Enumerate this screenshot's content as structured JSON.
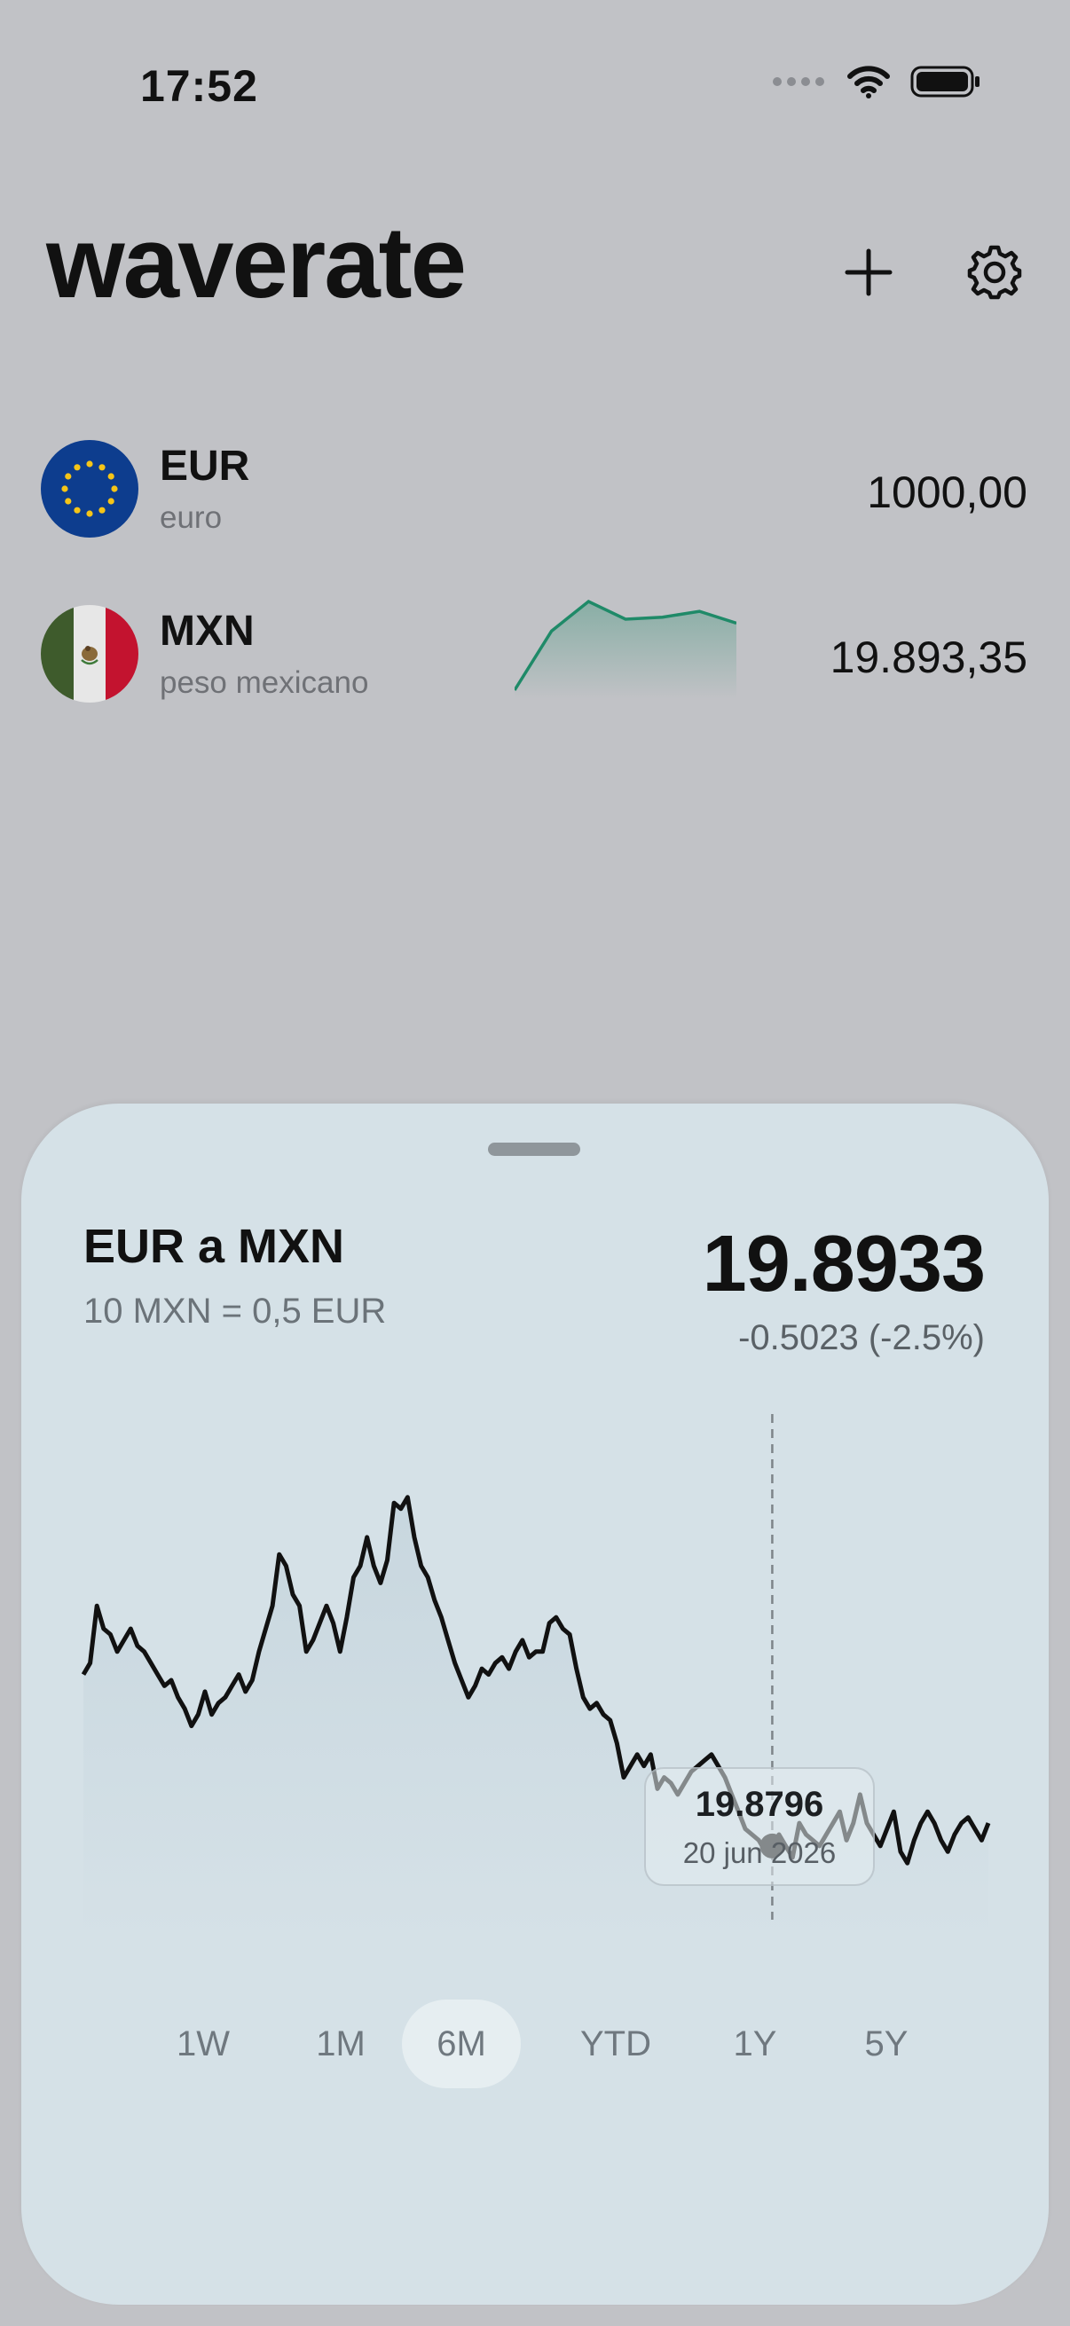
{
  "status": {
    "time": "17:52"
  },
  "app": {
    "title": "waverate"
  },
  "currencies": [
    {
      "code": "EUR",
      "name": "euro",
      "amount": "1000,00"
    },
    {
      "code": "MXN",
      "name": "peso mexicano",
      "amount": "19.893,35"
    }
  ],
  "sparkline": {
    "color": "#1f8a68",
    "values": [
      3.0,
      3.3,
      3.45,
      3.36,
      3.37,
      3.4,
      3.34
    ]
  },
  "sheet": {
    "pair_title": "EUR a MXN",
    "conversion_note": "10 MXN = 0,5 EUR",
    "rate": "19.8933",
    "change": "-0.5023 (-2.5%)",
    "tooltip": {
      "value": "19.8796",
      "date": "20 jun 2026"
    },
    "ranges": [
      "1W",
      "1M",
      "6M",
      "YTD",
      "1Y",
      "5Y"
    ],
    "active_range": "6M"
  },
  "chart_data": {
    "type": "line",
    "y": [
      20.16,
      20.18,
      20.28,
      20.24,
      20.23,
      20.2,
      20.22,
      20.24,
      20.21,
      20.2,
      20.18,
      20.16,
      20.14,
      20.15,
      20.12,
      20.1,
      20.07,
      20.09,
      20.13,
      20.09,
      20.11,
      20.12,
      20.14,
      20.16,
      20.13,
      20.15,
      20.2,
      20.24,
      20.28,
      20.37,
      20.35,
      20.3,
      20.28,
      20.2,
      20.22,
      20.25,
      20.28,
      20.25,
      20.2,
      20.26,
      20.33,
      20.35,
      20.4,
      20.35,
      20.32,
      20.36,
      20.46,
      20.45,
      20.47,
      20.4,
      20.35,
      20.33,
      20.29,
      20.26,
      20.22,
      20.18,
      20.15,
      20.12,
      20.14,
      20.17,
      20.16,
      20.18,
      20.19,
      20.17,
      20.2,
      20.22,
      20.19,
      20.2,
      20.2,
      20.25,
      20.26,
      20.24,
      20.23,
      20.17,
      20.12,
      20.1,
      20.11,
      20.09,
      20.08,
      20.04,
      19.98,
      20.0,
      20.02,
      20.0,
      20.02,
      19.96,
      19.98,
      19.97,
      19.95,
      19.97,
      19.99,
      20.0,
      20.01,
      20.02,
      20.0,
      19.98,
      19.95,
      19.92,
      19.89,
      19.88,
      19.87,
      19.85,
      19.86,
      19.88,
      19.86,
      19.84,
      19.9,
      19.88,
      19.87,
      19.86,
      19.88,
      19.9,
      19.92,
      19.87,
      19.9,
      19.95,
      19.9,
      19.88,
      19.86,
      19.89,
      19.92,
      19.85,
      19.83,
      19.87,
      19.9,
      19.92,
      19.9,
      19.87,
      19.85,
      19.88,
      19.9,
      19.91,
      19.89,
      19.87,
      19.9
    ],
    "ylim": [
      19.7,
      20.6
    ],
    "highlight_index": 102,
    "line_color": "#111111",
    "fill_color": "#c7d6de"
  }
}
